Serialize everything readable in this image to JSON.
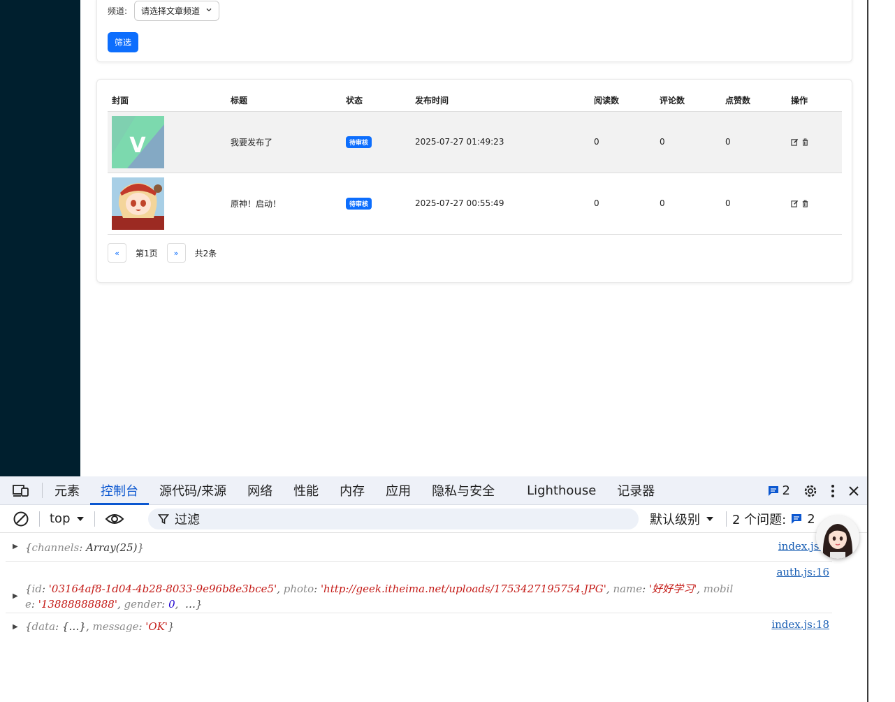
{
  "filter": {
    "channel_label": "频道:",
    "channel_placeholder": "请选择文章频道",
    "filter_button": "筛选"
  },
  "table": {
    "headers": [
      "封面",
      "标题",
      "状态",
      "发布时间",
      "阅读数",
      "评论数",
      "点赞数",
      "操作"
    ],
    "rows": [
      {
        "title": "我要发布了",
        "status": "待审核",
        "date": "2025-07-27 01:49:23",
        "reads": "0",
        "comments": "0",
        "likes": "0"
      },
      {
        "title": "原神！启动！",
        "status": "待审核",
        "date": "2025-07-27 00:55:49",
        "reads": "0",
        "comments": "0",
        "likes": "0"
      }
    ]
  },
  "pager": {
    "prev": "«",
    "page": "第1页",
    "next": "»",
    "total": "共2条"
  },
  "devtools": {
    "tabs": [
      "元素",
      "控制台",
      "源代码/来源",
      "网络",
      "性能",
      "内存",
      "应用",
      "隐私与安全",
      "Lighthouse",
      "记录器"
    ],
    "active_tab": "控制台",
    "message_count": "2",
    "context": "top",
    "filter_placeholder": "过滤",
    "level": "默认级别",
    "issues_label": "2 个问题:",
    "issues_count": "2",
    "logs": [
      {
        "src": "index.js:6"
      },
      {
        "src": "auth.js:16"
      },
      {
        "src": "index.js:18"
      }
    ],
    "log1": {
      "k1": "channels",
      "v1": "Array(25)"
    },
    "log2": {
      "k_id": "id",
      "v_id": "'03164af8-1d04-4b28-8033-9e96b8e3bce5'",
      "k_photo": "photo",
      "v_photo": "'http://geek.itheima.net/uploads/1753427195754.JPG'",
      "k_name": "name",
      "v_name": "'好好学习'",
      "k_mobile_a": "mobil",
      "k_mobile_b": "e",
      "v_mobile": "'13888888888'",
      "k_gender": "gender",
      "v_gender": "0",
      "more": "…"
    },
    "log3": {
      "k_data": "data",
      "v_data": "{…}",
      "k_msg": "message",
      "v_msg": "'OK'"
    }
  },
  "colors": {
    "sidebar": "#001f2e",
    "primary": "#0d6efd",
    "devtools_accent": "#0b57d0"
  }
}
